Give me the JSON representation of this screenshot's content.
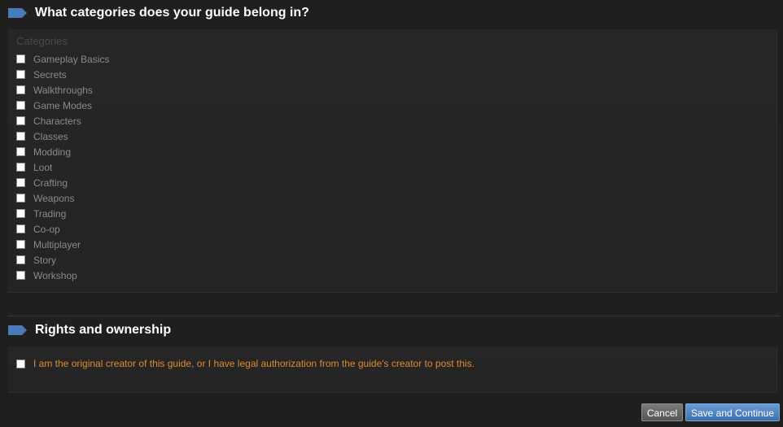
{
  "categories_section": {
    "title": "What categories does your guide belong in?",
    "label": "Categories",
    "items": [
      {
        "label": "Gameplay Basics",
        "checked": false
      },
      {
        "label": "Secrets",
        "checked": false
      },
      {
        "label": "Walkthroughs",
        "checked": false
      },
      {
        "label": "Game Modes",
        "checked": false
      },
      {
        "label": "Characters",
        "checked": false
      },
      {
        "label": "Classes",
        "checked": false
      },
      {
        "label": "Modding",
        "checked": false
      },
      {
        "label": "Loot",
        "checked": false
      },
      {
        "label": "Crafting",
        "checked": false
      },
      {
        "label": "Weapons",
        "checked": false
      },
      {
        "label": "Trading",
        "checked": false
      },
      {
        "label": "Co-op",
        "checked": false
      },
      {
        "label": "Multiplayer",
        "checked": false
      },
      {
        "label": "Story",
        "checked": false
      },
      {
        "label": "Workshop",
        "checked": false
      }
    ]
  },
  "rights_section": {
    "title": "Rights and ownership",
    "agreement_label": "I am the original creator of this guide, or I have legal authorization from the guide's creator to post this.",
    "agreement_checked": false
  },
  "buttons": {
    "cancel_label": "Cancel",
    "save_label": "Save and Continue"
  },
  "icons": {
    "section_marker": "blue-tag-icon"
  },
  "colors": {
    "background": "#1f1f1f",
    "accent_blue": "#4a7ab8",
    "warning_orange": "#e08b2f",
    "category_text": "#8b8b8b"
  }
}
